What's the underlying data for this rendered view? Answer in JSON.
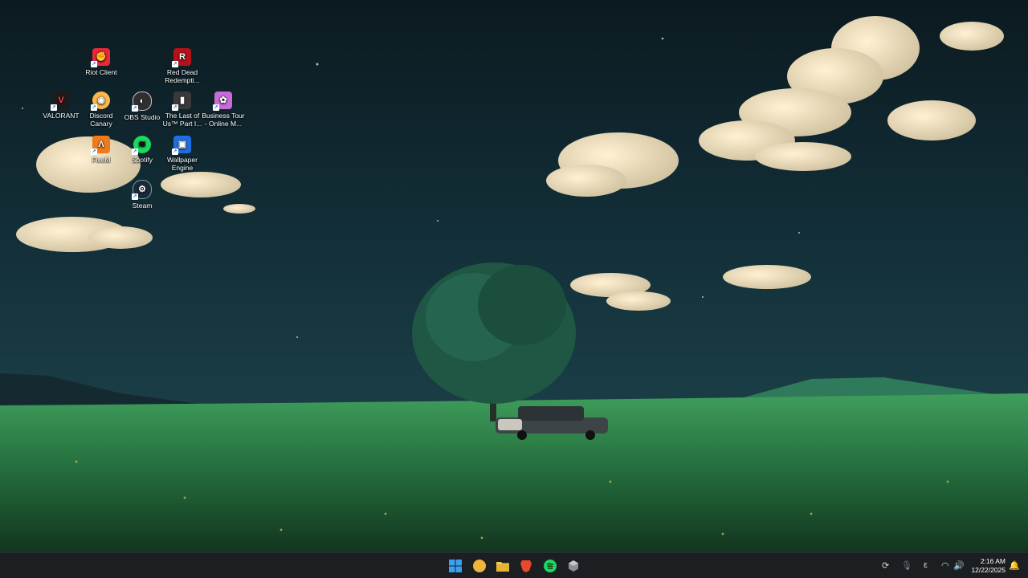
{
  "desktop": {
    "icons": [
      {
        "label": "Riot Client",
        "icon": "riot-client-icon",
        "color": "#e8283b"
      },
      {
        "label": "Red Dead Redempti...",
        "icon": "red-dead-redemption-icon",
        "color": "#b3121b"
      },
      {
        "label": "VALORANT",
        "icon": "valorant-icon",
        "color": "#ff4655"
      },
      {
        "label": "Discord Canary",
        "icon": "discord-canary-icon",
        "color": "#fbb848"
      },
      {
        "label": "OBS Studio",
        "icon": "obs-studio-icon",
        "color": "#302e31"
      },
      {
        "label": "The Last of Us™ Part I...",
        "icon": "the-last-of-us-icon",
        "color": "#3a3a3a"
      },
      {
        "label": "Business Tour - Online M...",
        "icon": "business-tour-icon",
        "color": "#c86ad8"
      },
      {
        "label": "FiveM",
        "icon": "fivem-icon",
        "color": "#f07a1a"
      },
      {
        "label": "Spotify",
        "icon": "spotify-icon",
        "color": "#1ed760"
      },
      {
        "label": "Wallpaper Engine",
        "icon": "wallpaper-engine-icon",
        "color": "#1f6fe0"
      },
      {
        "label": "Steam",
        "icon": "steam-icon",
        "color": "#1b2838"
      }
    ]
  },
  "taskbar": {
    "apps": [
      {
        "name": "start-button",
        "icon": "windows-start-icon",
        "color": "#3aa0f0"
      },
      {
        "name": "taskbar-discord",
        "icon": "discord-icon",
        "color": "#f2b33d"
      },
      {
        "name": "taskbar-file-explorer",
        "icon": "folder-icon",
        "color": "#f7c948"
      },
      {
        "name": "taskbar-brave",
        "icon": "brave-icon",
        "color": "#e8492a"
      },
      {
        "name": "taskbar-spotify",
        "icon": "spotify-icon",
        "color": "#1ed760"
      },
      {
        "name": "taskbar-app",
        "icon": "cube-icon",
        "color": "#8c8f93"
      }
    ],
    "tray": {
      "keyboard": "ε",
      "time": "2:16 AM",
      "date": "12/22/2025"
    }
  }
}
